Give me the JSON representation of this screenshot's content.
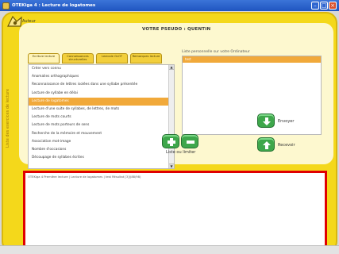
{
  "window": {
    "title": "OTEKiga 4 : Lecture de logatomes"
  },
  "header": {
    "author_label": "Auteur",
    "pseudo": "VOTRE PSEUDO : QUENTIN"
  },
  "sidebar": {
    "vertical_label": "Liste des exercices de lecture"
  },
  "tabs": [
    {
      "label": "Ecriture lecture"
    },
    {
      "label": "Connaissances structurelles"
    },
    {
      "label": "Lexicale GLOT"
    },
    {
      "label": "Remarques lecture"
    }
  ],
  "exercises": [
    "Créer vers connu",
    "Anomalies orthographiques",
    "Reconnaissance de lettres isolées dans une syllabe présentée",
    "Lecture de syllabe en délai",
    "Lecture de logatomes",
    "Lecture d'une suite de syllabes, de lettres, de mots",
    "Lecture de mots courts",
    "Lecture de mots porteurs de sens",
    "Recherche de la mémoire et mouvement",
    "Association mot-image",
    "Nombre d'occasions",
    "Découpage de syllabes écrites"
  ],
  "saved_panel": {
    "label": "Liste personnelle sur votre Ordinateur",
    "items": [
      "test"
    ]
  },
  "actions": {
    "add_remove_label": "Liste ou limiter",
    "send_label": "Envoyer",
    "receive_label": "Recevoir"
  },
  "result": {
    "text": "OTEKiga 4 Première lecture | Lecture de logatomes | test Résultat [3]/(88/98)"
  },
  "colors": {
    "frame": "#f4d81b",
    "highlight": "#f1a93a",
    "button_green": "#3ea74b",
    "result_border": "#e00000"
  }
}
